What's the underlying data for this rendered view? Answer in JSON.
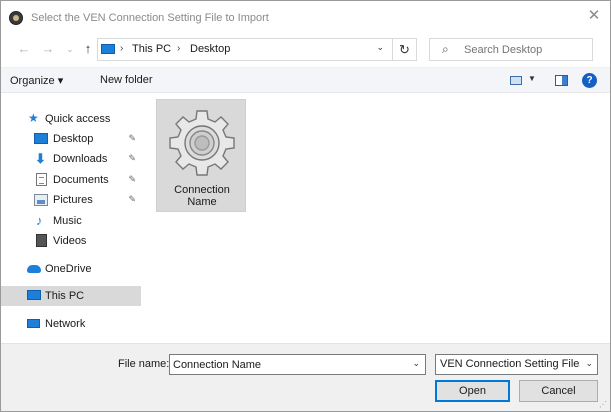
{
  "window": {
    "title": "Select the VEN Connection Setting File to Import",
    "close_glyph": "✕"
  },
  "nav": {
    "back_glyph": "←",
    "forward_glyph": "→",
    "recent_glyph": "⌄",
    "up_glyph": "↑",
    "breadcrumb": [
      "This PC",
      "Desktop"
    ],
    "separator_glyph": "›",
    "dropdown_glyph": "⌄",
    "refresh_glyph": "↻",
    "search_placeholder": "Search Desktop",
    "search_glyph": "⌕"
  },
  "toolbar": {
    "organize_label": "Organize ▾",
    "new_folder_label": "New folder",
    "view_dropdown_glyph": "▼",
    "help_glyph": "?"
  },
  "sidebar": {
    "items": [
      {
        "label": "Quick access",
        "icon": "star-icon",
        "pinned": false
      },
      {
        "label": "Desktop",
        "icon": "desktop-icon",
        "pinned": true
      },
      {
        "label": "Downloads",
        "icon": "download-icon",
        "pinned": true
      },
      {
        "label": "Documents",
        "icon": "document-icon",
        "pinned": true
      },
      {
        "label": "Pictures",
        "icon": "pictures-icon",
        "pinned": true
      },
      {
        "label": "Music",
        "icon": "music-icon",
        "pinned": false
      },
      {
        "label": "Videos",
        "icon": "videos-icon",
        "pinned": false
      },
      {
        "label": "OneDrive",
        "icon": "cloud-icon",
        "pinned": false
      },
      {
        "label": "This PC",
        "icon": "computer-icon",
        "pinned": false,
        "selected": true
      },
      {
        "label": "Network",
        "icon": "network-icon",
        "pinned": false
      }
    ],
    "pin_glyph": "📌"
  },
  "content": {
    "files": [
      {
        "name": "Connection Name",
        "name_line1": "Connection",
        "name_line2": "Name",
        "icon": "gear-icon",
        "selected": true
      }
    ]
  },
  "footer": {
    "file_name_label": "File name:",
    "file_name_value": "Connection Name",
    "file_name_dropdown_glyph": "⌄",
    "filter_label": "VEN Connection Setting Files (*",
    "filter_dropdown_glyph": "⌄",
    "open_label": "Open",
    "cancel_label": "Cancel"
  },
  "colors": {
    "accent": "#0078d7",
    "selection": "#d9d9d9",
    "folder_blue": "#1d7fd8"
  }
}
